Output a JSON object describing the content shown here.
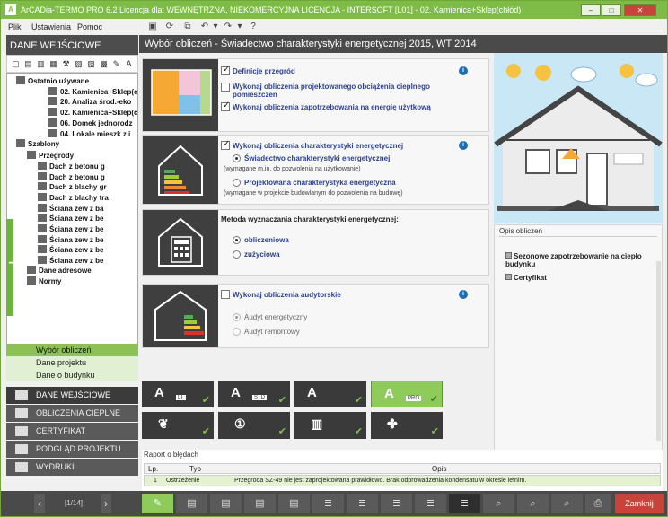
{
  "window": {
    "title": "ArCADia-TERMO PRO 6.2 Licencja dla: WEWNĘTRZNA, NIEKOMERCYJNA LICENCJA - INTERSOFT [L01] - 02. Kamienica+Sklep(chłód)"
  },
  "menu": [
    "Plik",
    "Ustawienia",
    "Pomoc"
  ],
  "left_panel": {
    "header": "DANE WEJŚCIOWE",
    "tree": [
      {
        "label": "Ostatnio używane",
        "indent": 0
      },
      {
        "label": "02. Kamienica+Sklep(c",
        "indent": 3
      },
      {
        "label": "20. Analiza środ.-eko",
        "indent": 3
      },
      {
        "label": "02. Kamienica+Sklep(c",
        "indent": 3
      },
      {
        "label": "06. Domek jednorodz",
        "indent": 3
      },
      {
        "label": "04. Lokale mieszk z i",
        "indent": 3
      },
      {
        "label": "Szablony",
        "indent": 0
      },
      {
        "label": "Przegrody",
        "indent": 1
      },
      {
        "label": "Dach z betonu g",
        "indent": 2
      },
      {
        "label": "Dach z betonu g",
        "indent": 2
      },
      {
        "label": "Dach z blachy gr",
        "indent": 2
      },
      {
        "label": "Dach z blachy tra",
        "indent": 2
      },
      {
        "label": "Ściana zew z ba",
        "indent": 2
      },
      {
        "label": "Ściana zew z be",
        "indent": 2
      },
      {
        "label": "Ściana zew z be",
        "indent": 2
      },
      {
        "label": "Ściana zew z be",
        "indent": 2
      },
      {
        "label": "Ściana zew z be",
        "indent": 2
      },
      {
        "label": "Ściana zew z be",
        "indent": 2
      },
      {
        "label": "Dane adresowe",
        "indent": 1
      },
      {
        "label": "Normy",
        "indent": 1
      }
    ],
    "submenu": [
      {
        "label": "Wybór obliczeń",
        "selected": true
      },
      {
        "label": "Dane projektu",
        "selected": false
      },
      {
        "label": "Dane o budynku",
        "selected": false
      }
    ],
    "sections": [
      {
        "label": "DANE WEJŚCIOWE",
        "active": true
      },
      {
        "label": "OBLICZENIA CIEPLNE",
        "active": false
      },
      {
        "label": "CERTYFIKAT",
        "active": false
      },
      {
        "label": "PODGLĄD PROJEKTU",
        "active": false
      },
      {
        "label": "WYDRUKI",
        "active": false
      }
    ]
  },
  "main": {
    "header": "Wybór obliczeń - Świadectwo charakterystyki energetycznej 2015, WT 2014",
    "card1": {
      "opt1": "Definicje przegród",
      "opt2": "Wykonaj obliczenia projektowanego obciążenia cieplnego pomieszczeń",
      "opt3": "Wykonaj obliczenia zapotrzebowania na energię użytkową"
    },
    "card2": {
      "opt1": "Wykonaj obliczenia charakterystyki energetycznej",
      "radio1": "Świadectwo charakterystyki energetycznej",
      "note1": "(wymagane m.in. do pozwolenia na użytkowanie)",
      "radio2": "Projektowana charakterystyka energetyczna",
      "note2": "(wymagane w projekcie budowlanym do pozwolenia na budowę)"
    },
    "card3": {
      "title": "Metoda wyznaczania charakterystyki energetycznej:",
      "radio1": "obliczeniowa",
      "radio2": "zużyciowa"
    },
    "card4": {
      "opt1": "Wykonaj obliczenia audytorskie",
      "radio1": "Audyt energetyczny",
      "radio2": "Audyt remontowy"
    },
    "tiles": [
      {
        "label": "LT"
      },
      {
        "label": "STD"
      },
      {
        "label": ""
      },
      {
        "label": "PRO",
        "selected": true
      },
      {
        "label": ""
      },
      {
        "label": ""
      },
      {
        "label": ""
      },
      {
        "label": ""
      }
    ],
    "opis": {
      "title": "Opis obliczeń",
      "items": [
        "Sezonowe zapotrzebowanie na ciepło budynku",
        "Certyfikat"
      ]
    },
    "raport": {
      "title": "Raport o błędach",
      "headers": [
        "Lp.",
        "Typ",
        "Opis"
      ],
      "rows": [
        {
          "lp": "1",
          "typ": "Ostrzeżenie",
          "opis": "Przegroda SZ-49 nie jest zaprojektowana prawidłowo. Brak odprowadzenia kondensatu w okresie letnim."
        }
      ]
    }
  },
  "footer": {
    "page": "[1/14]",
    "close": "Zamknij"
  },
  "colors": {
    "accent": "#7fbb47",
    "dark": "#4a4a4a",
    "link": "#2a3f8f"
  }
}
